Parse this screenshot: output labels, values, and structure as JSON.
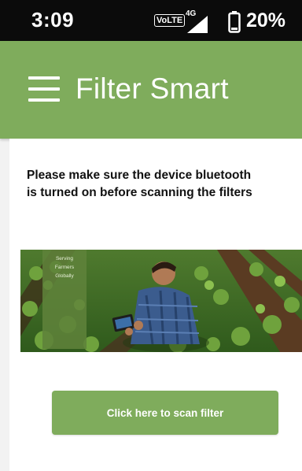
{
  "status_bar": {
    "time": "3:09",
    "volte": "VoLTE",
    "network": "4G",
    "battery": "20%"
  },
  "app_bar": {
    "title": "Filter Smart",
    "menu_icon": "hamburger-menu-icon"
  },
  "main": {
    "notice_line1": "Please make sure the device bluetooth",
    "notice_line2": "is turned on before scanning the filters",
    "banner": {
      "tag_line1": "Serving",
      "tag_line2": "Farmers",
      "tag_line3": "Globally"
    },
    "scan_button_label": "Click here to scan filter"
  },
  "colors": {
    "status_bar": "#0b0b0b",
    "accent_green": "#7fac5c",
    "background": "#ffffff"
  }
}
